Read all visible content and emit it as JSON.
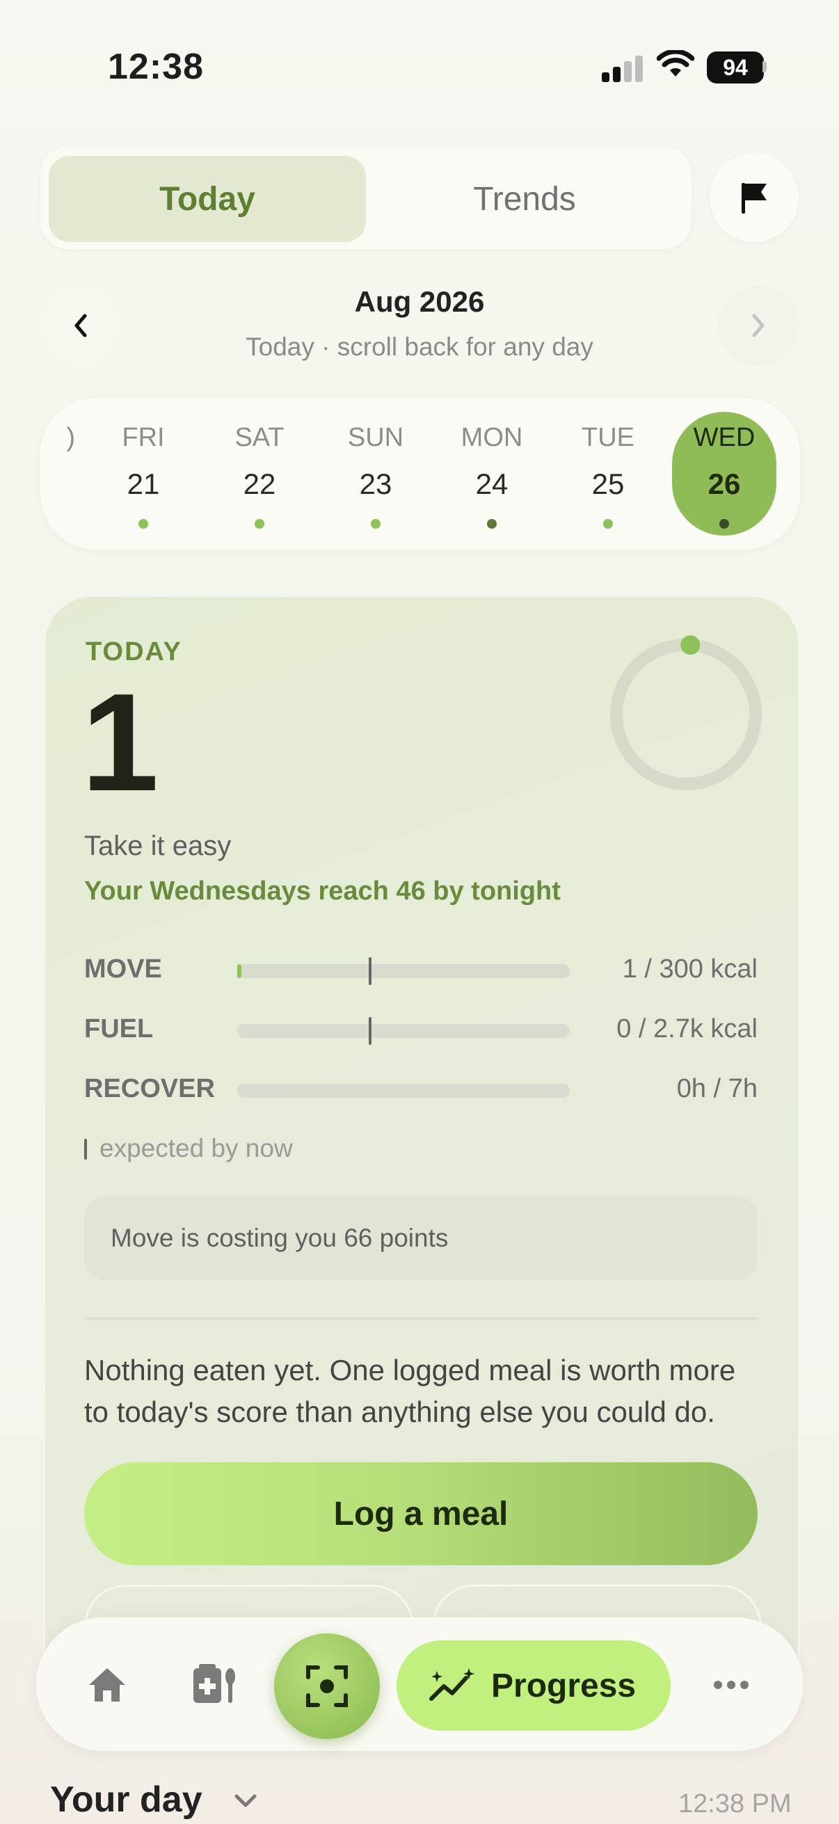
{
  "status_bar": {
    "time": "12:38",
    "battery": "94"
  },
  "tabs": {
    "today": "Today",
    "trends": "Trends"
  },
  "header": {
    "month": "Aug 2026",
    "subtitle": "Today · scroll back for any day"
  },
  "days": [
    {
      "dow": "FRI",
      "num": "21"
    },
    {
      "dow": "SAT",
      "num": "22"
    },
    {
      "dow": "SUN",
      "num": "23"
    },
    {
      "dow": "MON",
      "num": "24"
    },
    {
      "dow": "TUE",
      "num": "25"
    },
    {
      "dow": "WED",
      "num": "26",
      "selected": true
    }
  ],
  "card": {
    "label": "TODAY",
    "score": "1",
    "tagline": "Take it easy",
    "reach": "Your Wednesdays reach 46 by tonight",
    "ring_fraction": 0.01,
    "metrics": [
      {
        "label": "MOVE",
        "value": "1 / 300 kcal",
        "fill": 0.003,
        "expected": 0.4
      },
      {
        "label": "FUEL",
        "value": "0 / 2.7k kcal",
        "fill": 0,
        "expected": 0.4
      },
      {
        "label": "RECOVER",
        "value": "0h / 7h",
        "fill": 0,
        "expected": null
      }
    ],
    "legend": "expected by now",
    "costing": "Move is costing you 66 points",
    "note": "Nothing eaten yet. One logged meal is worth more to today's score than anything else you could do.",
    "cta": "Log a meal"
  },
  "bottom_nav": {
    "progress": "Progress"
  },
  "section": {
    "title": "Your day",
    "time": "12:38 PM"
  },
  "colors": {
    "accent": "#8fbc56",
    "accent_text": "#6b8b3c",
    "pill": "#c2f07f"
  }
}
